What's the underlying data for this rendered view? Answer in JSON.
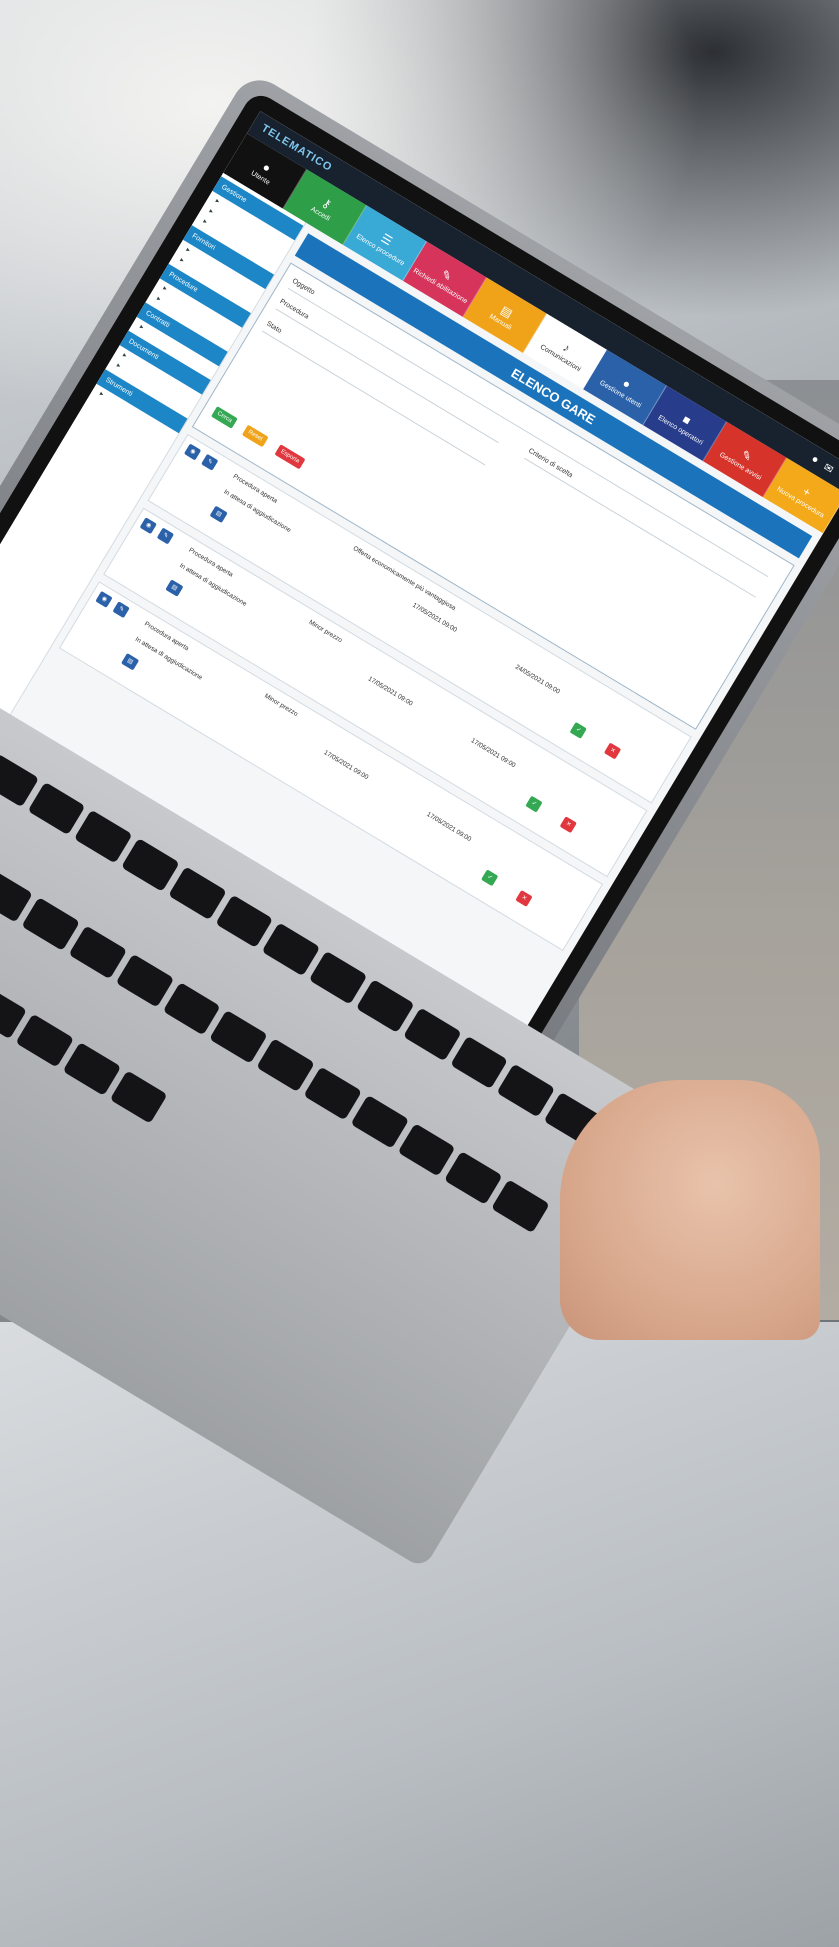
{
  "app": {
    "brand": "TELEMATICO",
    "page_title": "ELENCO GARE"
  },
  "tiles": [
    {
      "label": "Utente",
      "color": "#111111"
    },
    {
      "label": "Accedi",
      "color": "#2e9e48"
    },
    {
      "label": "Elenco procedure",
      "color": "#39a9d6"
    },
    {
      "label": "Richiedi abilitazione",
      "color": "#d7345b"
    },
    {
      "label": "Manuali",
      "color": "#f0a319"
    },
    {
      "label": "Comunicazioni",
      "color": "#ffffff"
    },
    {
      "label": "Gestione utenti",
      "color": "#2a61a8"
    },
    {
      "label": "Elenco operatori",
      "color": "#273c8b"
    },
    {
      "label": "Gestione avvisi",
      "color": "#d6332b"
    },
    {
      "label": "Nuova procedura",
      "color": "#f3a91a"
    }
  ],
  "filter": {
    "object_label": "Oggetto",
    "procedure_label": "Procedura",
    "criteria_label": "Criterio di scelta",
    "state_label": "Stato",
    "search_btn": "Cerca",
    "reset_btn": "Reset",
    "export_btn": "Esporta"
  },
  "rows": [
    {
      "procedure": "Procedura aperta",
      "criterion": "Offerta economicamente più vantaggiosa",
      "state": "In attesa di aggiudicazione",
      "deadline": "17/05/2021 09:00",
      "opening": "24/05/2021 09:00"
    },
    {
      "procedure": "Procedura aperta",
      "criterion": "Minor prezzo",
      "state": "In attesa di aggiudicazione",
      "deadline": "17/05/2021 09:00",
      "opening": "17/05/2021 09:00"
    },
    {
      "procedure": "Procedura aperta",
      "criterion": "Minor prezzo",
      "state": "In attesa di aggiudicazione",
      "deadline": "17/05/2021 09:00",
      "opening": "17/05/2021 09:00"
    }
  ],
  "sidebar": {
    "sections": [
      "Gestione",
      "Fornitori",
      "Procedure",
      "Contratti",
      "Documenti",
      "Strumenti"
    ]
  }
}
